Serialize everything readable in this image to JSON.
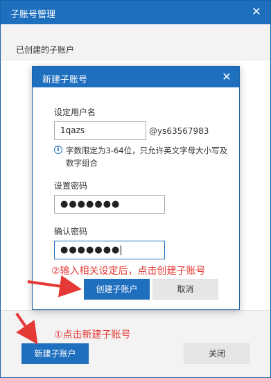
{
  "window": {
    "title": "子账号管理",
    "close_glyph": "✕",
    "section_label": "已创建的子账户",
    "create_button": "新建子账户",
    "close_button": "关闭"
  },
  "modal": {
    "title": "新建子账号",
    "close_glyph": "✕",
    "username_label": "设定用户名",
    "username_value": "1qazs",
    "domain_suffix": "@ys63567983",
    "info_glyph": "i",
    "hint": "字数限定为3-64位，只允许英文字母大小写及数字组合",
    "password_label": "设置密码",
    "password_value": "●●●●●●●",
    "confirm_label": "确认密码",
    "confirm_value": "●●●●●●●",
    "create_button": "创建子账户",
    "cancel_button": "取消"
  },
  "annotations": {
    "step2": "②输入相关设定后，点击创建子账号",
    "step1": "①点击新建子账号"
  },
  "colors": {
    "accent": "#1f6fbf",
    "annotation": "#e53935"
  },
  "icons": [
    "close-icon",
    "info-icon",
    "arrow-icon"
  ]
}
